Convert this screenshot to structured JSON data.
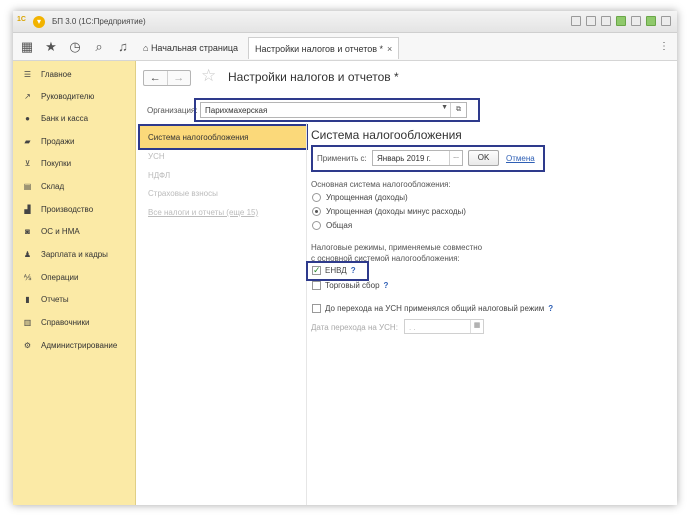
{
  "window": {
    "title": "БП 3.0  (1С:Предприятие)",
    "logo": "1С"
  },
  "tabs": {
    "home": "Начальная страница",
    "active": "Настройки налогов и отчетов *",
    "close": "×"
  },
  "sidebar": {
    "items": [
      {
        "label": "Главное",
        "icon": "menu-icon"
      },
      {
        "label": "Руководителю",
        "icon": "chart-line-icon"
      },
      {
        "label": "Банк и касса",
        "icon": "coin-icon"
      },
      {
        "label": "Продажи",
        "icon": "bag-icon"
      },
      {
        "label": "Покупки",
        "icon": "cart-icon"
      },
      {
        "label": "Склад",
        "icon": "warehouse-icon"
      },
      {
        "label": "Производство",
        "icon": "factory-icon"
      },
      {
        "label": "ОС и НМА",
        "icon": "car-icon"
      },
      {
        "label": "Зарплата и кадры",
        "icon": "people-icon"
      },
      {
        "label": "Операции",
        "icon": "operations-icon"
      },
      {
        "label": "Отчеты",
        "icon": "bar-chart-icon"
      },
      {
        "label": "Справочники",
        "icon": "book-icon"
      },
      {
        "label": "Администрирование",
        "icon": "gear-icon"
      }
    ]
  },
  "page": {
    "title": "Настройки налогов и отчетов *",
    "org_label": "Организация:",
    "org_value": "Парихмахерская"
  },
  "left_nav": {
    "active": "Система налогообложения",
    "items": [
      "УСН",
      "НДФЛ",
      "Страховые взносы",
      "Все налоги и отчеты (еще 15)"
    ]
  },
  "tax_system": {
    "title": "Система налогообложения",
    "apply_label": "Применить с:",
    "apply_value": "Январь 2019 г.",
    "ok": "OK",
    "cancel": "Отмена",
    "main_label": "Основная система налогообложения:",
    "options": [
      "Упрощенная (доходы)",
      "Упрощенная (доходы минус расходы)",
      "Общая"
    ],
    "selected_option": "Упрощенная (доходы минус расходы)",
    "combined_label_1": "Налоговые режимы, применяемые совместно",
    "combined_label_2": "с основной системой налогообложения:",
    "envd": "ЕНВД",
    "envd_checked": true,
    "trade_fee": "Торговый сбор",
    "trade_fee_checked": false,
    "help": "?",
    "pre_usn": "До перехода на УСН применялся общий налоговый режим",
    "pre_usn_checked": false,
    "transition_label": "Дата перехода на УСН:",
    "transition_value": ". .",
    "dots": "..."
  },
  "colors": {
    "sidebar_bg": "#fbeaa6",
    "active_item_bg": "#fbd97a",
    "highlight_frame": "#2e3a8c",
    "link": "#2e5fb5"
  }
}
